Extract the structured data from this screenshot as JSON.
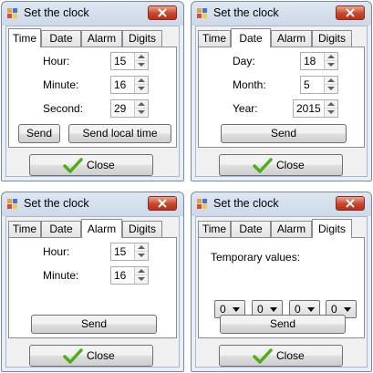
{
  "windows": [
    {
      "title": "Set the clock",
      "tabs": [
        "Time",
        "Date",
        "Alarm",
        "Digits"
      ],
      "active_tab": "Time"
    },
    {
      "title": "Set the clock",
      "tabs": [
        "Time",
        "Date",
        "Alarm",
        "Digits"
      ],
      "active_tab": "Date"
    },
    {
      "title": "Set the clock",
      "tabs": [
        "Time",
        "Date",
        "Alarm",
        "Digits"
      ],
      "active_tab": "Alarm"
    },
    {
      "title": "Set the clock",
      "tabs": [
        "Time",
        "Date",
        "Alarm",
        "Digits"
      ],
      "active_tab": "Digits"
    }
  ],
  "time_tab": {
    "hour_label": "Hour:",
    "hour_value": "15",
    "minute_label": "Minute:",
    "minute_value": "16",
    "second_label": "Second:",
    "second_value": "29",
    "send_label": "Send",
    "send_local_label": "Send local time"
  },
  "date_tab": {
    "day_label": "Day:",
    "day_value": "18",
    "month_label": "Month:",
    "month_value": "5",
    "year_label": "Year:",
    "year_value": "2015",
    "send_label": "Send"
  },
  "alarm_tab": {
    "hour_label": "Hour:",
    "hour_value": "15",
    "minute_label": "Minute:",
    "minute_value": "16",
    "send_label": "Send"
  },
  "digits_tab": {
    "temp_label": "Temporary values:",
    "digits": [
      "0",
      "0",
      "0",
      "0"
    ],
    "send_label": "Send"
  },
  "close_label": "Close",
  "colors": {
    "check_green": "#4caf1a",
    "close_red": "#c9462b"
  }
}
